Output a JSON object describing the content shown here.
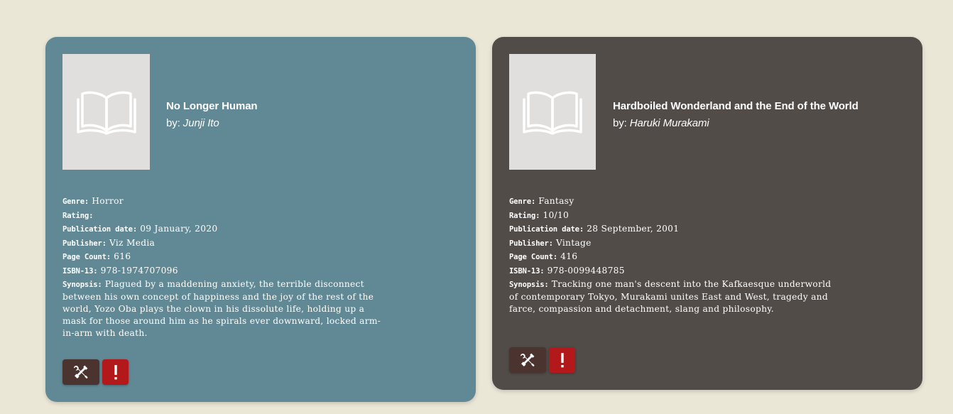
{
  "colors": {
    "page_background": "#ebe7d7",
    "card1_background": "#618995",
    "card2_background": "#524c48",
    "edit_button": "#4b3330",
    "report_button": "#b3191a",
    "cover_placeholder": "#e0dfde"
  },
  "icons": {
    "cover": "open-book-icon",
    "edit": "tools-icon",
    "report": "exclamation-icon"
  },
  "labels": {
    "by": "by:",
    "genre": "Genre:",
    "rating": "Rating:",
    "publication_date": "Publication date:",
    "publisher": "Publisher:",
    "page_count": "Page Count:",
    "isbn": "ISBN-13:",
    "synopsis": "Synopsis:"
  },
  "books": [
    {
      "title": "No Longer Human",
      "author": "Junji Ito",
      "genre": "Horror",
      "rating": "",
      "publication_date": "09 January, 2020",
      "publisher": "Viz Media",
      "page_count": "616",
      "isbn": "978-1974707096",
      "synopsis": "Plagued by a maddening anxiety, the terrible disconnect between his own concept of happiness and the joy of the rest of the world, Yozo Oba plays the clown in his dissolute life, holding up a mask for those around him as he spirals ever downward, locked arm-in-arm with death."
    },
    {
      "title": "Hardboiled Wonderland and the End of the World",
      "author": "Haruki Murakami",
      "genre": "Fantasy",
      "rating": "10/10",
      "publication_date": "28 September, 2001",
      "publisher": "Vintage",
      "page_count": "416",
      "isbn": "978-0099448785",
      "synopsis": "Tracking one man's descent into the Kafkaesque underworld of contemporary Tokyo, Murakami unites East and West, tragedy and farce, compassion and detachment, slang and philosophy."
    }
  ]
}
